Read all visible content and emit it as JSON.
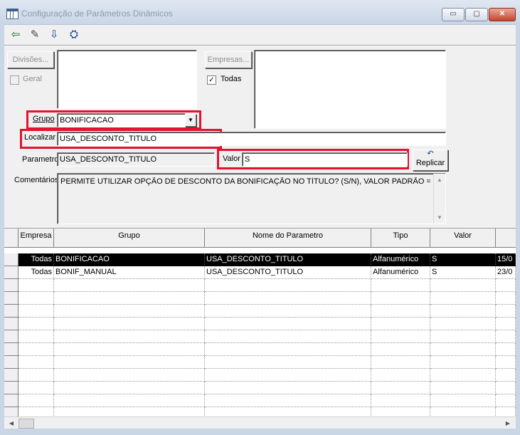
{
  "window": {
    "title": "Configuração de Parâmetros Dinâmicos",
    "controls": {
      "minimize": "▭",
      "maximize": "▢",
      "close": "✕"
    }
  },
  "toolbar": {
    "buttons": [
      {
        "name": "exit-icon",
        "glyph": "⇦"
      },
      {
        "name": "eraser-icon",
        "glyph": "✎"
      },
      {
        "name": "save-icon",
        "glyph": "⇩"
      },
      {
        "name": "binoculars-icon",
        "glyph": "⛭"
      }
    ]
  },
  "form": {
    "divisoes_button": "Divisões...",
    "geral_label": "Geral",
    "empresas_button": "Empresas...",
    "todas_label": "Todas",
    "todas_check": "✓",
    "grupo_label": "Grupo",
    "grupo_value": "BONIFICACAO",
    "localizar_label": "Localizar",
    "localizar_value": "USA_DESCONTO_TITULO",
    "parametro_label": "Parametro",
    "parametro_value": "USA_DESCONTO_TITULO",
    "valor_label": "Valor",
    "valor_value": "S",
    "replicar_button": "Replicar",
    "comentarios_label": "Comentários",
    "comentarios_value": "PERMITE UTILIZAR OPÇÃO DE DESCONTO DA BONIFICAÇÃO NO TÍTULO? (S/N), VALOR PADRÃO = N"
  },
  "grid": {
    "columns": [
      "Empresa",
      "Grupo",
      "Nome do Parametro",
      "Tipo",
      "Valor",
      ""
    ],
    "rows": [
      [
        "Todas",
        "BONIFICACAO",
        "USA_DESCONTO_TITULO",
        "Alfanumérico",
        "S",
        "15/0"
      ],
      [
        "Todas",
        "BONIF_MANUAL",
        "USA_DESCONTO_TITULO",
        "Alfanumérico",
        "S",
        "23/0"
      ]
    ]
  },
  "colors": {
    "highlight": "#e8112d",
    "selected_row": "#000000"
  }
}
